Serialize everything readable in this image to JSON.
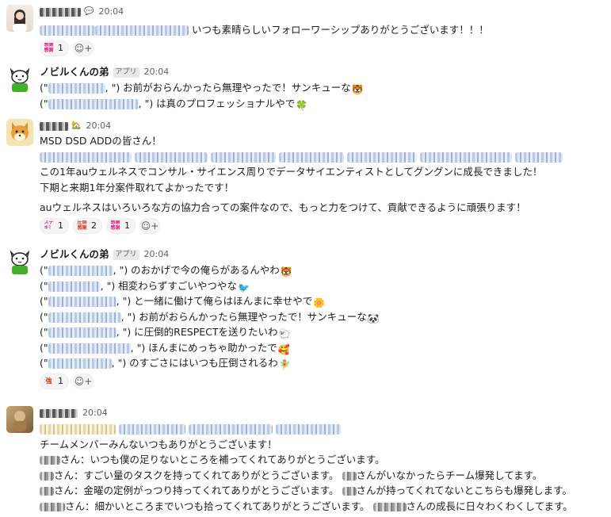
{
  "messages": [
    {
      "time": "20:04",
      "line1_text": "いつも素晴らしいフォローワーシップありがとうございます！！！",
      "reaction1": {
        "icon": "感謝\n感謝",
        "count": "1"
      }
    },
    {
      "name": "ノビルくんの弟",
      "tag": "アプリ",
      "time": "20:04",
      "lines": [
        {
          "prefix": "(\"",
          "suffix": ", \") お前がおらんかったら無理やったで！サンキューな",
          "emoji": "🐯"
        },
        {
          "prefix": "(\"",
          "suffix": ", \") は真のプロフェッショナルやで",
          "emoji": "🍀"
        }
      ]
    },
    {
      "time": "20:04",
      "title": "MSD DSD ADDの皆さん！",
      "lines": [
        "この1年auウェルネスでコンサル・サイエンス周りでデータサイエンティストとしてグングンに成長できました！",
        "下期と来期1年分案件取れてよかったです！",
        "auウェルネスはいろいろな方の協力合っての案件なので、もっと力をつけて、貢献できるように頑張ります！"
      ],
      "reactions": [
        {
          "icon": "ステ\nキ！",
          "count": "1"
        },
        {
          "icon": "圧倒\n的感謝",
          "count": "2"
        },
        {
          "icon": "感謝\n感謝",
          "count": "1"
        }
      ]
    },
    {
      "name": "ノビルくんの弟",
      "tag": "アプリ",
      "time": "20:04",
      "lines": [
        {
          "suffix": ", \") のおかげで今の俺らがあるんやわ",
          "emoji": "🐯"
        },
        {
          "suffix": ", \") 相変わらずすごいやつやな",
          "emoji": "🐦"
        },
        {
          "suffix": ", \") と一緒に働けて俺らはほんまに幸せやで",
          "emoji": "🌼"
        },
        {
          "suffix": ", \") お前がおらんかったら無理やったで！サンキューな",
          "emoji": "🐼"
        },
        {
          "suffix": ", \") に圧倒的RESPECTを送りたいわ",
          "emoji": "🐑"
        },
        {
          "suffix": ", \") ほんまにめっちゃ助かったで",
          "emoji": "🥰"
        },
        {
          "suffix": ", \") のすごさにはいつも圧倒されるわ",
          "emoji": "🧚"
        }
      ],
      "reaction1": {
        "icon": "強い",
        "count": "1"
      }
    },
    {
      "time": "20:04",
      "lines": [
        "チームメンバーみんないつもありがとうございます！",
        "さん：いつも僕の足りないところを補ってくれてありがとうございます。",
        "さん：すごい量のタスクを持ってくれてありがとうございます。",
        "さん：金曜の定例がっつり持ってくれてありがとうございます。",
        "さん：細かいところまでいつも拾ってくれてありがとうございます。"
      ],
      "line_tails": [
        "",
        "",
        "さんがいなかったらチーム爆発してます。",
        "さんが持ってくれてないとこちらも爆発します。",
        "さんの成長に日々わくわくしてます。"
      ]
    }
  ]
}
